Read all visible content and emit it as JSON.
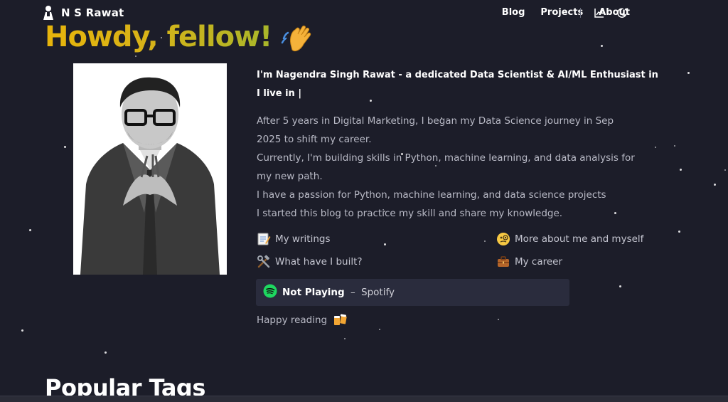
{
  "header": {
    "brand_name": "N S Rawat",
    "nav": [
      {
        "label": "Blog"
      },
      {
        "label": "Projects"
      },
      {
        "label": "About"
      }
    ],
    "icons": [
      "analytics-icon",
      "moon-icon"
    ]
  },
  "hero": {
    "greeting": "Howdy, fellow!",
    "greeting_emoji": "waving-hand-icon",
    "intro_line": "I'm Nagendra Singh Rawat - a dedicated Data Scientist & AI/ML Enthusiast in",
    "live_line": "I live in |",
    "paragraphs": [
      "After 5 years in Digital Marketing, I began my Data Science journey in Sep 2025 to shift my career.",
      "Currently, I'm building skills in Python, machine learning, and data analysis for my new path.",
      "I have a passion for Python, machine learning, and data science projects",
      "I started this blog to practice my skill and share my knowledge."
    ]
  },
  "links": [
    {
      "label": "My writings",
      "icon": "memo-icon"
    },
    {
      "label": "More about me and myself",
      "icon": "monocle-face-icon"
    },
    {
      "label": "What have I built?",
      "icon": "hammer-wrench-icon"
    },
    {
      "label": "My career",
      "icon": "briefcase-icon"
    }
  ],
  "spotify": {
    "status": "Not Playing",
    "separator": "–",
    "service": "Spotify"
  },
  "footer_note": {
    "text": "Happy reading",
    "icon": "beer-mugs-icon"
  },
  "sections": {
    "popular_tags_title": "Popular Tags"
  },
  "colors": {
    "background": "#1c1d29",
    "greeting_gradient_start": "#e7b40b",
    "greeting_gradient_end": "#a8b62a",
    "spotify_green": "#1ed760",
    "card_bg": "#2a2c3d"
  }
}
